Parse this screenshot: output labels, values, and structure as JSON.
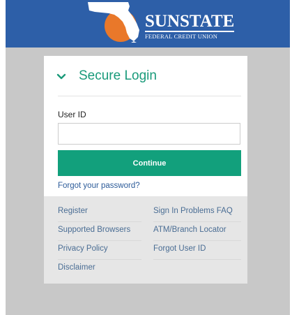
{
  "header": {
    "logo_name": "SUNSTATE",
    "logo_subtitle": "FEDERAL CREDIT UNION"
  },
  "login": {
    "title": "Secure Login",
    "user_id_label": "User ID",
    "user_id_value": "",
    "continue_label": "Continue",
    "forgot_password_label": "Forgot your password?"
  },
  "links": {
    "left": [
      "Register",
      "Supported Browsers",
      "Privacy Policy",
      "Disclaimer"
    ],
    "right": [
      "Sign In Problems FAQ",
      "ATM/Branch Locator",
      "Forgot User ID"
    ]
  },
  "colors": {
    "header_blue": "#2d5fa8",
    "accent_green": "#12a07c",
    "title_green": "#199a7a",
    "link_blue": "#2c5b99",
    "backdrop_gray": "#c8c8c8",
    "links_panel_gray": "#e6e6e6"
  }
}
